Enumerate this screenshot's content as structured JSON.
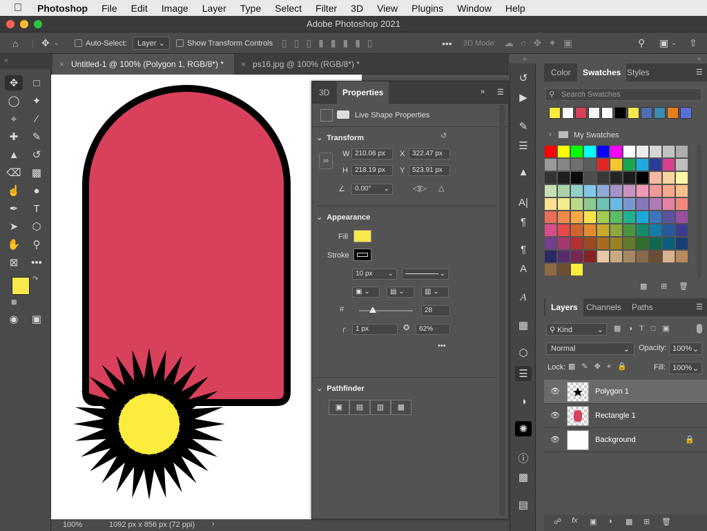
{
  "menubar": {
    "app": "Photoshop",
    "items": [
      "File",
      "Edit",
      "Image",
      "Layer",
      "Type",
      "Select",
      "Filter",
      "3D",
      "View",
      "Plugins",
      "Window",
      "Help"
    ]
  },
  "window": {
    "title": "Adobe Photoshop 2021"
  },
  "options": {
    "auto_select": "Auto-Select:",
    "layer_select": "Layer",
    "transform_controls": "Show Transform Controls",
    "mode_3d": "3D Mode:"
  },
  "tabs": [
    "Untitled-1 @ 100% (Polygon 1, RGB/8*) *",
    "ps16.jpg @ 100% (RGB/8*) *"
  ],
  "status": {
    "zoom": "100%",
    "doc_size": "1092 px x 856 px (72 ppi)"
  },
  "colors": {
    "fill": "#f9e84b",
    "shape": "#d8405c",
    "stroke": "#000000",
    "star_center": "#fbec3e"
  },
  "properties": {
    "tabs": [
      "3D",
      "Properties"
    ],
    "title": "Live Shape Properties",
    "transform": {
      "label": "Transform",
      "w_label": "W",
      "w": "210.06 px",
      "x_label": "X",
      "x": "322.47 px",
      "h_label": "H",
      "h": "218.19 px",
      "y_label": "Y",
      "y": "523.91 px",
      "angle": "0.00°"
    },
    "appearance": {
      "label": "Appearance",
      "fill_label": "Fill",
      "stroke_label": "Stroke",
      "stroke_width": "10 px",
      "star_count": "28",
      "corner_radius": "1 px",
      "star_ratio": "62%"
    },
    "pathfinder": {
      "label": "Pathfinder"
    }
  },
  "swatches": {
    "tabs": [
      "Color",
      "Swatches",
      "Styles"
    ],
    "search_placeholder": "Search Swatches",
    "folder": "My Swatches",
    "recent": [
      "#fbec3e",
      "#ffffff",
      "#d8405c",
      "#f4f4f4",
      "#ffffff",
      "#000000",
      "#f9e84b",
      "#4a6fb5",
      "#3a8fb0",
      "#e87d1e",
      "#5a6fd6"
    ],
    "grid": [
      [
        "#ff0000",
        "#ffff00",
        "#00ff00",
        "#00ffff",
        "#0000ff",
        "#ff00ff",
        "#ffffff",
        "#ebebeb",
        "#d6d6d6",
        "#c2c2c2",
        "#adadad"
      ],
      [
        "#999999",
        "#858585",
        "#707070",
        "#5c5c5c",
        "#e22626",
        "#f2c62e",
        "#1aa653",
        "#1ea9e0",
        "#2a3c9c",
        "#d6408d",
        "#bfbfbf"
      ],
      [
        "#333333",
        "#1f1f1f",
        "#0a0a0a",
        "#4d4d4d",
        "#383838",
        "#242424",
        "#1a1a1a",
        "#000000",
        "#f7b9a1",
        "#f9d49c",
        "#fef6a4"
      ],
      [
        "#c6e0b4",
        "#a9d3a8",
        "#8fd1c5",
        "#7fc8ea",
        "#8eaadb",
        "#a493c9",
        "#c893c1",
        "#f197b8",
        "#f4999a",
        "#f7a98a",
        "#f9c08c"
      ],
      [
        "#fde18f",
        "#f5ed8b",
        "#bcd98a",
        "#8cc98f",
        "#6cc3b6",
        "#6ab9e4",
        "#7b97cf",
        "#8877bd",
        "#b07bb5",
        "#e581a4",
        "#ef8a7c"
      ],
      [
        "#ea6d58",
        "#f08848",
        "#f7a945",
        "#fbe34a",
        "#a4cc55",
        "#5bbd63",
        "#22b08c",
        "#1aa7d8",
        "#3e74bd",
        "#5a53a3",
        "#98509e"
      ],
      [
        "#d94c8c",
        "#e44848",
        "#d2632f",
        "#e18b2d",
        "#c8a92c",
        "#8aa83b",
        "#47963f",
        "#148b6a",
        "#117fa8",
        "#255a9c",
        "#3e3c8c"
      ],
      [
        "#733e8d",
        "#a6386f",
        "#b0312f",
        "#9d4a22",
        "#a76c1e",
        "#9a8222",
        "#657a2b",
        "#2f6f2e",
        "#0d6a50",
        "#0a5f7f",
        "#173f74"
      ],
      [
        "#2a2964",
        "#562c6a",
        "#7b2753",
        "#86221f",
        "#e6c8a4",
        "#c9a882",
        "#a88763",
        "#89694a",
        "#6b4e33",
        "#dab28a",
        "#b88a5e"
      ],
      [
        "#8f6a44",
        "#6d4e30",
        "#fbec3e"
      ]
    ]
  },
  "layers": {
    "tabs": [
      "Layers",
      "Channels",
      "Paths"
    ],
    "filter_kind": "Kind",
    "blend_mode": "Normal",
    "opacity_label": "Opacity:",
    "opacity": "100%",
    "lock_label": "Lock:",
    "fill_label": "Fill:",
    "fill": "100%",
    "items": [
      "Polygon 1",
      "Rectangle 1",
      "Background"
    ]
  }
}
